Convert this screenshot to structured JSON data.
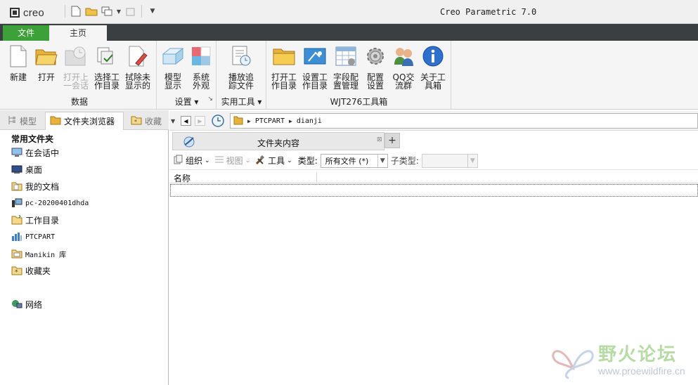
{
  "titlebar": {
    "logo": "creo",
    "app_title": "Creo Parametric 7.0",
    "quick_access_icons": [
      "new-file-icon",
      "open-folder-icon",
      "window-icon",
      "dropdown-icon",
      "close-window-icon",
      "customize-dropdown-icon"
    ]
  },
  "ribbon_tabs": [
    {
      "label": "文件",
      "color": "#3da13a"
    },
    {
      "label": "主页"
    }
  ],
  "ribbon": {
    "groups": [
      {
        "label": "数据",
        "buttons": [
          {
            "label": "新建",
            "icon": "new-document-icon"
          },
          {
            "label": "打开",
            "icon": "open-folder-icon"
          },
          {
            "label": "打开上\n一会话",
            "icon": "open-last-session-icon",
            "disabled": true
          },
          {
            "label": "选择工\n作目录",
            "icon": "select-working-dir-icon"
          },
          {
            "label": "拭除未\n显示的",
            "icon": "erase-not-displayed-icon"
          }
        ]
      },
      {
        "label": "设置",
        "buttons": [
          {
            "label": "模型\n显示",
            "icon": "model-display-icon"
          },
          {
            "label": "系统\n外观",
            "icon": "system-appearance-icon"
          }
        ]
      },
      {
        "label": "实用工具",
        "buttons": [
          {
            "label": "播放追\n踪文件",
            "icon": "play-trail-file-icon"
          }
        ]
      },
      {
        "label": "WJT276工具箱",
        "buttons": [
          {
            "label": "打开工\n作目录",
            "icon": "open-working-dir-icon"
          },
          {
            "label": "设置工\n作目录",
            "icon": "set-working-dir-icon"
          },
          {
            "label": "字段配\n置管理",
            "icon": "field-config-icon"
          },
          {
            "label": "配置\n设置",
            "icon": "gear-icon"
          },
          {
            "label": "QQ交\n流群",
            "icon": "qq-group-icon"
          },
          {
            "label": "关于工\n具箱",
            "icon": "info-icon"
          }
        ]
      }
    ]
  },
  "left_panel": {
    "tabs": [
      {
        "label": "模型",
        "icon": "model-tree-icon"
      },
      {
        "label": "文件夹浏览器",
        "icon": "folder-browser-icon"
      },
      {
        "label": "收藏",
        "icon": "favorites-icon"
      }
    ],
    "heading": "常用文件夹",
    "items": [
      {
        "label": "在会话中",
        "icon": "monitor-icon"
      },
      {
        "label": "桌面",
        "icon": "desktop-icon"
      },
      {
        "label": "我的文档",
        "icon": "documents-icon"
      },
      {
        "label": "pc-20200401dhda",
        "icon": "computer-icon"
      },
      {
        "label": "工作目录",
        "icon": "working-dir-icon"
      },
      {
        "label": "PTCPART",
        "icon": "ptcpart-icon"
      },
      {
        "label": "Manikin 库",
        "icon": "library-icon"
      },
      {
        "label": "收藏夹",
        "icon": "favorites-icon"
      },
      {
        "label": "网络",
        "icon": "network-icon"
      }
    ]
  },
  "address_bar": {
    "path": [
      "PTCPART",
      "dianji"
    ]
  },
  "content_tab": {
    "title": "文件夹内容",
    "plus": "+"
  },
  "toolbar2": {
    "organize": "组织",
    "view": "视图",
    "tools": "工具",
    "type_label": "类型:",
    "type_value": "所有文件 (*)",
    "subtype_label": "子类型:"
  },
  "list": {
    "column_name": "名称"
  },
  "watermark": {
    "title": "野火论坛",
    "url": "www.proewildfire.cn"
  }
}
